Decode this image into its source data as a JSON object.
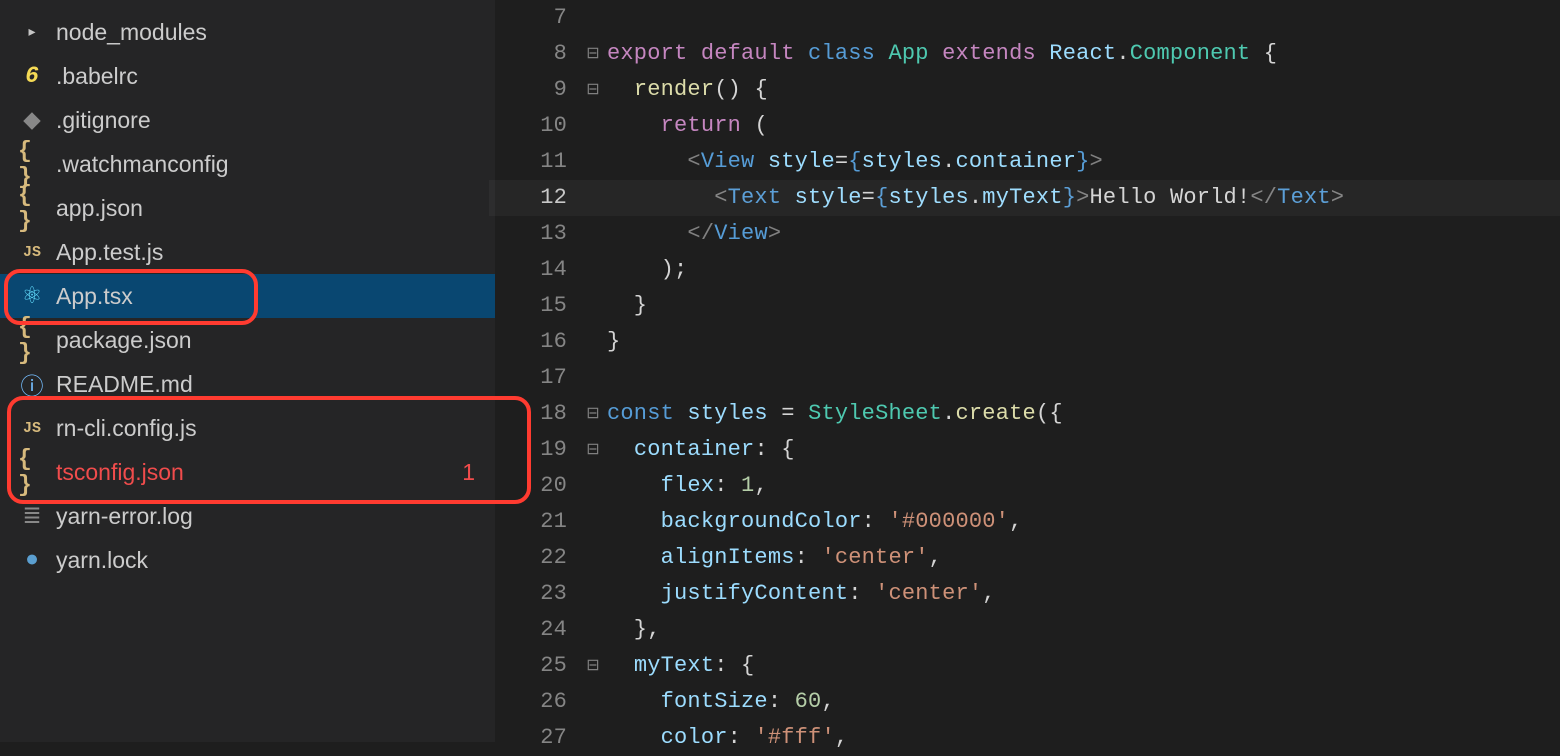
{
  "sidebar": {
    "files": [
      {
        "name": "node_modules",
        "icon": "folder",
        "selected": false,
        "error": false
      },
      {
        "name": ".babelrc",
        "icon": "babel",
        "selected": false,
        "error": false
      },
      {
        "name": ".gitignore",
        "icon": "git",
        "selected": false,
        "error": false
      },
      {
        "name": ".watchmanconfig",
        "icon": "json",
        "selected": false,
        "error": false
      },
      {
        "name": "app.json",
        "icon": "json",
        "selected": false,
        "error": false
      },
      {
        "name": "App.test.js",
        "icon": "js",
        "selected": false,
        "error": false
      },
      {
        "name": "App.tsx",
        "icon": "react",
        "selected": true,
        "error": false
      },
      {
        "name": "package.json",
        "icon": "json",
        "selected": false,
        "error": false
      },
      {
        "name": "README.md",
        "icon": "info",
        "selected": false,
        "error": false
      },
      {
        "name": "rn-cli.config.js",
        "icon": "js",
        "selected": false,
        "error": false
      },
      {
        "name": "tsconfig.json",
        "icon": "json",
        "selected": false,
        "error": true,
        "badge": "1"
      },
      {
        "name": "yarn-error.log",
        "icon": "log",
        "selected": false,
        "error": false
      },
      {
        "name": "yarn.lock",
        "icon": "lock",
        "selected": false,
        "error": false
      }
    ]
  },
  "editor": {
    "active_line": 12,
    "first_line": 7,
    "last_line": 27,
    "code_text": "export default class App extends React.Component {\n  render() {\n    return (\n      <View style={styles.container}>\n        <Text style={styles.myText}>Hello World!</Text>\n      </View>\n    );\n  }\n}\n\nconst styles = StyleSheet.create({\n  container: {\n    flex: 1,\n    backgroundColor: '#000000',\n    alignItems: 'center',\n    justifyContent: 'center',\n  },\n  myText: {\n    fontSize: 60,\n    color: '#fff',",
    "tokens": {
      "l8": [
        [
          "export ",
          "kw"
        ],
        [
          "default ",
          "kw"
        ],
        [
          "class ",
          "cls"
        ],
        [
          "App ",
          "type"
        ],
        [
          "extends ",
          "kw"
        ],
        [
          "React",
          "var"
        ],
        [
          ".",
          "pun"
        ],
        [
          "Component ",
          "type"
        ],
        [
          "{",
          "pun"
        ]
      ],
      "l9": [
        [
          "  ",
          "pun"
        ],
        [
          "render",
          "fn"
        ],
        [
          "() {",
          "pun"
        ]
      ],
      "l10": [
        [
          "    ",
          "pun"
        ],
        [
          "return ",
          "kw"
        ],
        [
          "(",
          "pun"
        ]
      ],
      "l11": [
        [
          "      ",
          "pun"
        ],
        [
          "<",
          "tagbr"
        ],
        [
          "View ",
          "tag"
        ],
        [
          "style",
          "attr"
        ],
        [
          "=",
          "pun"
        ],
        [
          "{",
          "cls"
        ],
        [
          "styles",
          "var"
        ],
        [
          ".",
          "pun"
        ],
        [
          "container",
          "var"
        ],
        [
          "}",
          "cls"
        ],
        [
          ">",
          "tagbr"
        ]
      ],
      "l12": [
        [
          "        ",
          "pun"
        ],
        [
          "<",
          "tagbr"
        ],
        [
          "Text ",
          "tag"
        ],
        [
          "style",
          "attr"
        ],
        [
          "=",
          "pun"
        ],
        [
          "{",
          "cls"
        ],
        [
          "styles",
          "var"
        ],
        [
          ".",
          "pun"
        ],
        [
          "myText",
          "var"
        ],
        [
          "}",
          "cls"
        ],
        [
          ">",
          "tagbr"
        ],
        [
          "Hello World!",
          "txt"
        ],
        [
          "</",
          "tagbr"
        ],
        [
          "Text",
          "tag"
        ],
        [
          ">",
          "tagbr"
        ]
      ],
      "l13": [
        [
          "      ",
          "pun"
        ],
        [
          "</",
          "tagbr"
        ],
        [
          "View",
          "tag"
        ],
        [
          ">",
          "tagbr"
        ]
      ],
      "l14": [
        [
          "    );",
          "pun"
        ]
      ],
      "l15": [
        [
          "  }",
          "pun"
        ]
      ],
      "l16": [
        [
          "}",
          "pun"
        ]
      ],
      "l17": [],
      "l18": [
        [
          "const ",
          "cls"
        ],
        [
          "styles ",
          "var"
        ],
        [
          "= ",
          "pun"
        ],
        [
          "StyleSheet",
          "type"
        ],
        [
          ".",
          "pun"
        ],
        [
          "create",
          "fn"
        ],
        [
          "({",
          "pun"
        ]
      ],
      "l19": [
        [
          "  ",
          "pun"
        ],
        [
          "container",
          "prop"
        ],
        [
          ": {",
          "pun"
        ]
      ],
      "l20": [
        [
          "    ",
          "pun"
        ],
        [
          "flex",
          "prop"
        ],
        [
          ": ",
          "pun"
        ],
        [
          "1",
          "num"
        ],
        [
          ",",
          "pun"
        ]
      ],
      "l21": [
        [
          "    ",
          "pun"
        ],
        [
          "backgroundColor",
          "prop"
        ],
        [
          ": ",
          "pun"
        ],
        [
          "'#000000'",
          "str"
        ],
        [
          ",",
          "pun"
        ]
      ],
      "l22": [
        [
          "    ",
          "pun"
        ],
        [
          "alignItems",
          "prop"
        ],
        [
          ": ",
          "pun"
        ],
        [
          "'center'",
          "str"
        ],
        [
          ",",
          "pun"
        ]
      ],
      "l23": [
        [
          "    ",
          "pun"
        ],
        [
          "justifyContent",
          "prop"
        ],
        [
          ": ",
          "pun"
        ],
        [
          "'center'",
          "str"
        ],
        [
          ",",
          "pun"
        ]
      ],
      "l24": [
        [
          "  },",
          "pun"
        ]
      ],
      "l25": [
        [
          "  ",
          "pun"
        ],
        [
          "myText",
          "prop"
        ],
        [
          ": {",
          "pun"
        ]
      ],
      "l26": [
        [
          "    ",
          "pun"
        ],
        [
          "fontSize",
          "prop"
        ],
        [
          ": ",
          "pun"
        ],
        [
          "60",
          "num"
        ],
        [
          ",",
          "pun"
        ]
      ],
      "l27": [
        [
          "    ",
          "pun"
        ],
        [
          "color",
          "prop"
        ],
        [
          ": ",
          "pun"
        ],
        [
          "'#fff'",
          "str"
        ],
        [
          ",",
          "pun"
        ]
      ]
    },
    "fold_markers": {
      "8": "⊟",
      "9": "⊟",
      "11": "",
      "12": "",
      "18": "⊟",
      "19": "⊟",
      "25": "⊟"
    }
  },
  "icons_glyph": {
    "folder": "▸",
    "babel": "6",
    "git": "◆",
    "json": "{ }",
    "js": "JS",
    "react": "⚛",
    "info": "ⓘ",
    "log": "≣",
    "lock": "●"
  }
}
